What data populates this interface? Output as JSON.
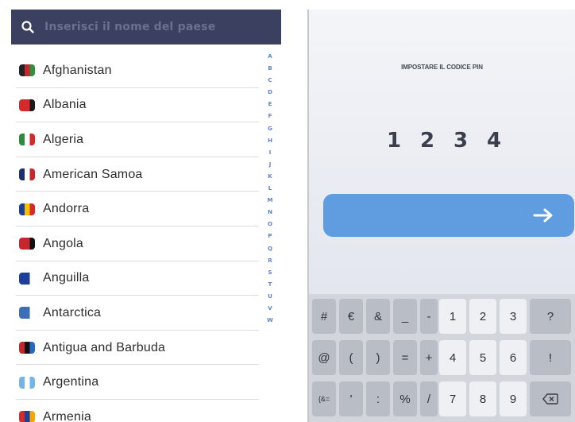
{
  "search": {
    "placeholder": "Inserisci il nome del paese"
  },
  "countries": [
    {
      "name": "Afghanistan",
      "flag": [
        "#222222",
        "#c8262e",
        "#2f8f3e"
      ]
    },
    {
      "name": "Albania",
      "flag": [
        "#d42a2a",
        "#d42a2a",
        "#1a1a1a"
      ]
    },
    {
      "name": "Algeria",
      "flag": [
        "#2e8b3d",
        "#ffffff",
        "#d42a2a"
      ]
    },
    {
      "name": "American Samoa",
      "flag": [
        "#1a2f6b",
        "#ffffff",
        "#c8262e"
      ]
    },
    {
      "name": "Andorra",
      "flag": [
        "#1d3f9a",
        "#f5c400",
        "#d42a2a"
      ]
    },
    {
      "name": "Angola",
      "flag": [
        "#c8262e",
        "#c8262e",
        "#111111"
      ]
    },
    {
      "name": "Anguilla",
      "flag": [
        "#1d3f9a",
        "#1d3f9a",
        "#ffffff"
      ]
    },
    {
      "name": "Antarctica",
      "flag": [
        "#3c6fb8",
        "#3c6fb8",
        "#ffffff"
      ]
    },
    {
      "name": "Antigua and Barbuda",
      "flag": [
        "#c8262e",
        "#111111",
        "#2a67c0"
      ]
    },
    {
      "name": "Argentina",
      "flag": [
        "#74b4e6",
        "#ffffff",
        "#74b4e6"
      ]
    },
    {
      "name": "Armenia",
      "flag": [
        "#d42a2a",
        "#1d3f9a",
        "#f2a800"
      ]
    }
  ],
  "alphabet": [
    "A",
    "B",
    "C",
    "D",
    "E",
    "F",
    "G",
    "H",
    "I",
    "J",
    "K",
    "L",
    "M",
    "N",
    "O",
    "P",
    "Q",
    "R",
    "S",
    "T",
    "U",
    "V",
    "W"
  ],
  "pin": {
    "title": "IMPOSTARE IL CODICE PIN",
    "digits": [
      "1",
      "2",
      "3",
      "4"
    ]
  },
  "keyboard": {
    "rows": [
      [
        "#",
        "€",
        "&",
        "_",
        "-",
        "1",
        "2",
        "3",
        "?"
      ],
      [
        "@",
        "(",
        ")",
        "=",
        "+",
        "4",
        "5",
        "6",
        "!"
      ],
      [
        "{&=",
        "'",
        ":",
        "%",
        "/",
        "7",
        "8",
        "9",
        "⌫"
      ]
    ]
  },
  "colors": {
    "search_bar": "#3b3f60",
    "alphabet_index": "#5c83c9",
    "submit_button": "#5f9ce0"
  },
  "icons": [
    "search-icon",
    "arrow-right-icon",
    "backspace-icon"
  ]
}
